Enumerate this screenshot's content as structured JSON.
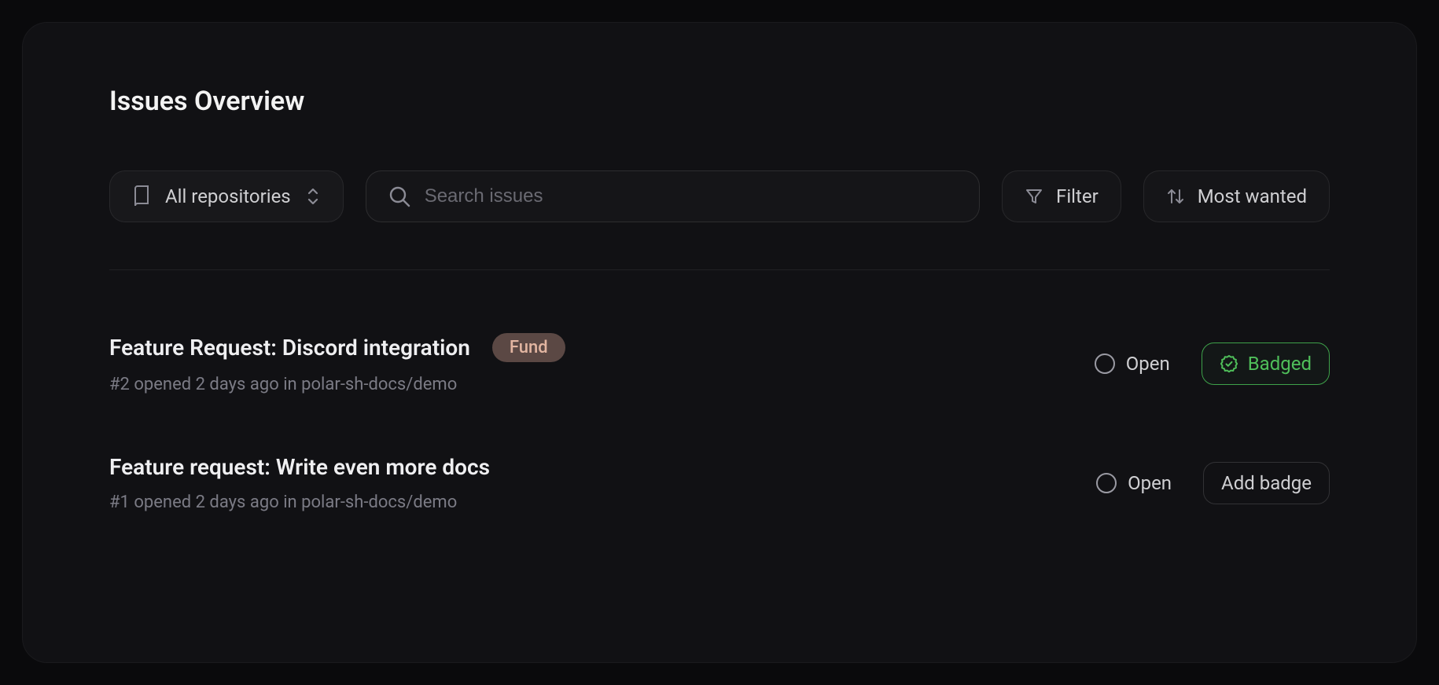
{
  "header": {
    "title": "Issues Overview"
  },
  "toolbar": {
    "repo_select_label": "All repositories",
    "search_placeholder": "Search issues",
    "filter_label": "Filter",
    "sort_label": "Most wanted"
  },
  "issues": [
    {
      "title": "Feature Request: Discord integration",
      "tag": "Fund",
      "meta": "#2 opened 2 days ago in polar-sh-docs/demo",
      "status": "Open",
      "badge_state": "badged",
      "badge_label": "Badged"
    },
    {
      "title": "Feature request: Write even more docs",
      "tag": null,
      "meta": "#1 opened 2 days ago in polar-sh-docs/demo",
      "status": "Open",
      "badge_state": "add",
      "badge_label": "Add badge"
    }
  ]
}
